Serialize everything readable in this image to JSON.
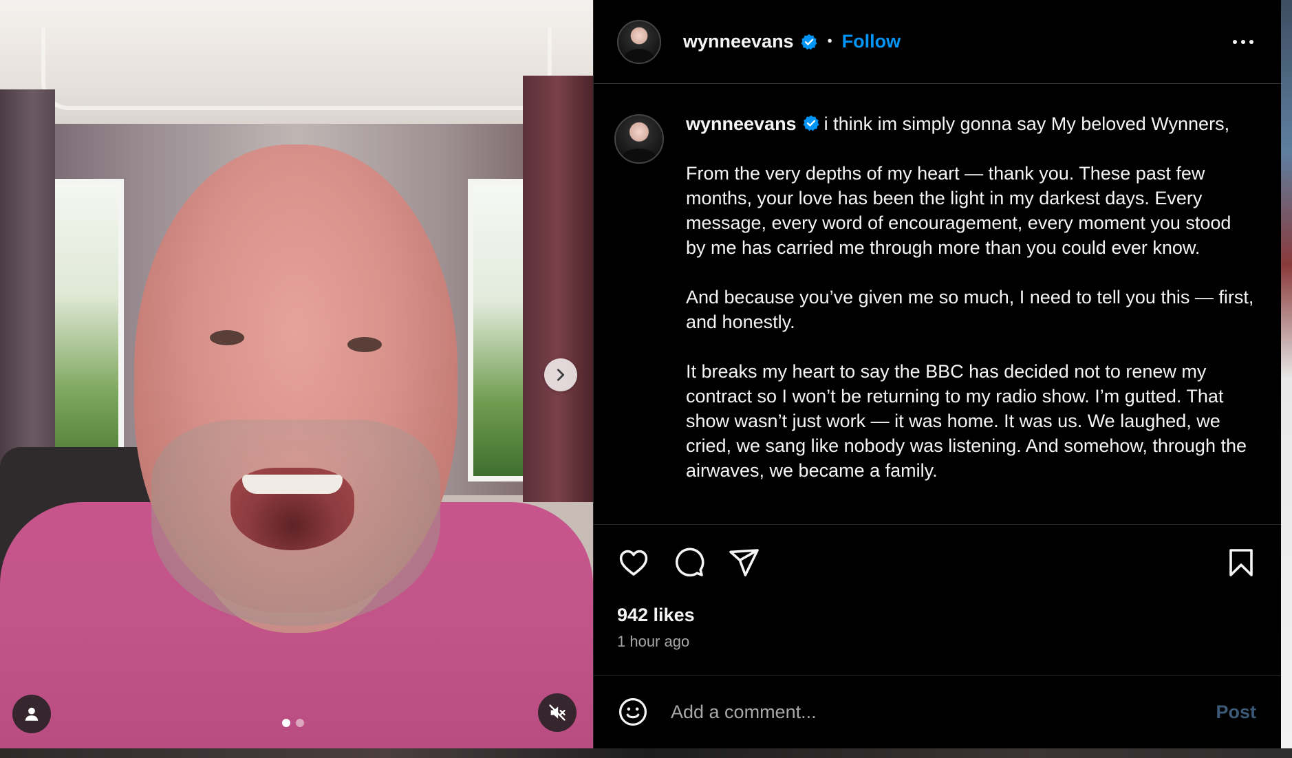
{
  "post": {
    "username": "wynneevans",
    "follow_label": "Follow",
    "separator": "•",
    "caption_intro": "i think im simply gonna say My beloved Wynners,",
    "caption_paragraphs": [
      "From the very depths of my heart — thank you. These past few months, your love has been the light in my darkest days. Every message, every word of encouragement, every moment you stood by me has carried me through more than you could ever know.",
      "And because you’ve given me so much, I need to tell you this — first, and honestly.",
      "It breaks my heart to say the BBC has decided not to renew my contract so I won’t be returning to my radio show. I’m gutted. That show wasn’t just work — it was home. It was us. We laughed, we cried, we sang like nobody was listening. And somehow, through the airwaves, we became a family."
    ],
    "likes": "942 likes",
    "time": "1 hour ago",
    "comment_placeholder": "Add a comment...",
    "post_label": "Post"
  },
  "media": {
    "carousel_total": 2,
    "carousel_active": 1
  },
  "icons": {
    "verified": "verified-badge-icon",
    "more": "more-options-icon",
    "next": "chevron-right-icon",
    "user_tag": "person-icon",
    "mute": "speaker-muted-icon",
    "like": "heart-icon",
    "comment": "comment-bubble-icon",
    "share": "paper-plane-icon",
    "save": "bookmark-icon",
    "emoji": "smiley-icon"
  },
  "colors": {
    "accent": "#0095f6",
    "post_disabled": "#3c5a77",
    "panel_bg": "#000000",
    "secondary_text": "#a8a8a8"
  }
}
